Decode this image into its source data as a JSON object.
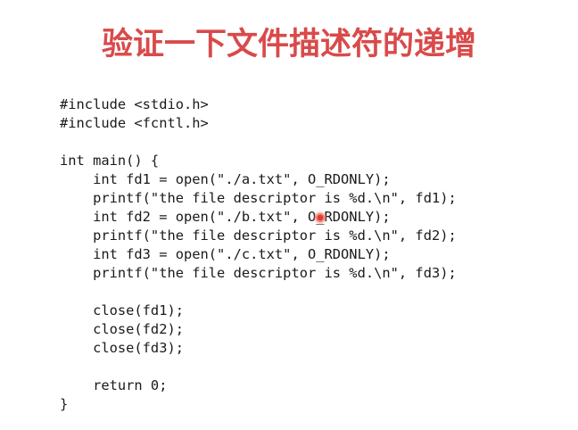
{
  "slide": {
    "title": "验证一下文件描述符的递增",
    "code_lines": [
      "#include <stdio.h>",
      "#include <fcntl.h>",
      "",
      "int main() {",
      "    int fd1 = open(\"./a.txt\", O_RDONLY);",
      "    printf(\"the file descriptor is %d.\\n\", fd1);",
      "    int fd2 = open(\"./b.txt\", O_RDONLY);",
      "    printf(\"the file descriptor is %d.\\n\", fd2);",
      "    int fd3 = open(\"./c.txt\", O_RDONLY);",
      "    printf(\"the file descriptor is %d.\\n\", fd3);",
      "",
      "    close(fd1);",
      "    close(fd2);",
      "    close(fd3);",
      "",
      "    return 0;",
      "}"
    ]
  },
  "colors": {
    "title": "#d94a4a",
    "code_text": "#1a1a1a",
    "background": "#ffffff",
    "pointer": "#e23b2e"
  }
}
